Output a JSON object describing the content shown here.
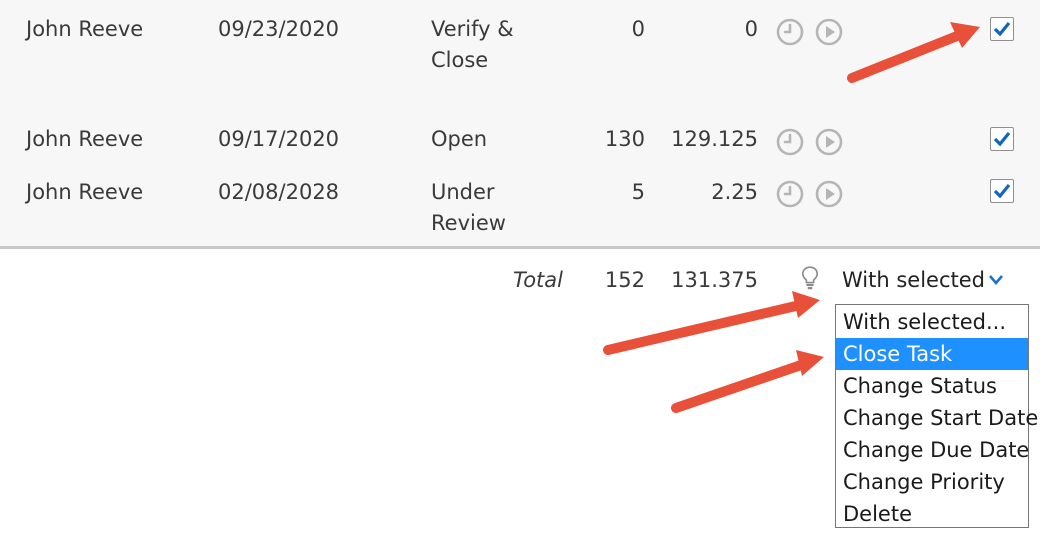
{
  "rows": [
    {
      "name": "John Reeve",
      "date": "09/23/2020",
      "status_line1": "Verify &",
      "status_line2": "Close",
      "count": "0",
      "hours": "0",
      "checked": true
    },
    {
      "name": "John Reeve",
      "date": "09/17/2020",
      "status_line1": "Open",
      "status_line2": "",
      "count": "130",
      "hours": "129.125",
      "checked": true
    },
    {
      "name": "John Reeve",
      "date": "02/08/2028",
      "status_line1": "Under",
      "status_line2": "Review",
      "count": "5",
      "hours": "2.25",
      "checked": true
    }
  ],
  "footer": {
    "total_label": "Total",
    "total_count": "152",
    "total_hours": "131.375",
    "with_selected_label": "With selected"
  },
  "dropdown": {
    "items": [
      "With selected...",
      "Close Task",
      "Change Status",
      "Change Start Date",
      "Change Due Date",
      "Change Priority",
      "Delete"
    ],
    "selected_index": 1
  },
  "icons": {
    "row_icons": [
      "clock-icon",
      "play-icon"
    ],
    "footer_icon": "lightbulb-icon",
    "dropdown_icon": "chevron-down-icon",
    "check_icon": "checkmark-icon"
  },
  "colors": {
    "row_bg": "#f7f7f7",
    "selection": "#1e90ff",
    "check": "#1565c0",
    "annotation_arrow": "#e8503a"
  }
}
